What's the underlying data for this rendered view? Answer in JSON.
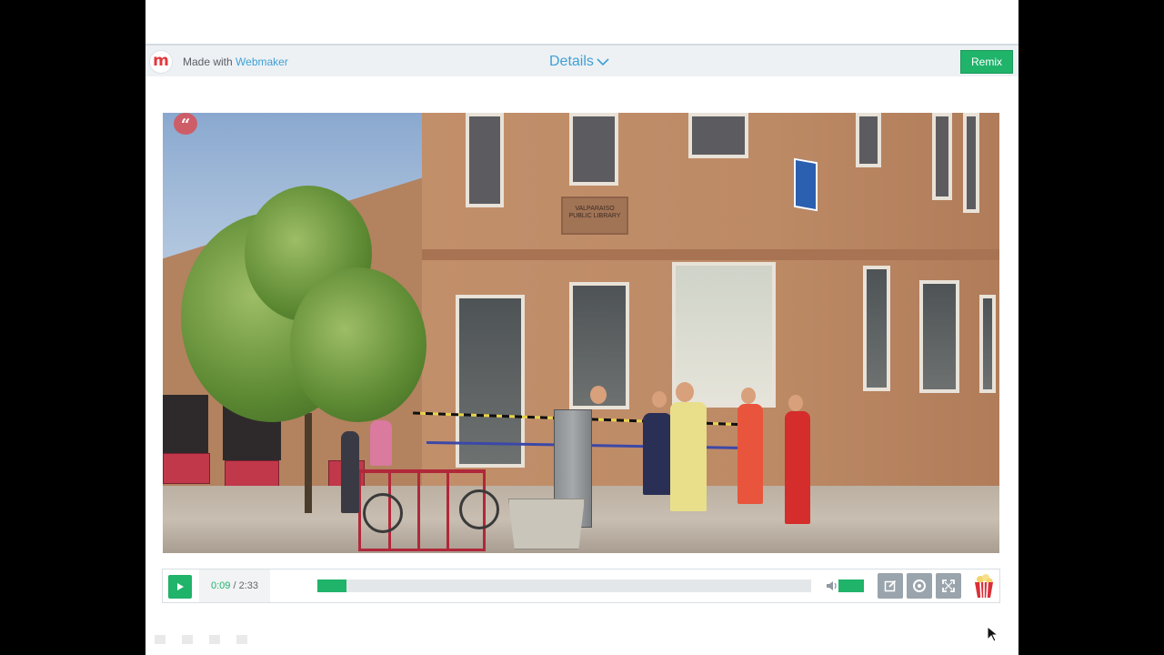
{
  "header": {
    "logo_letter": "m",
    "made_with_prefix": "Made with",
    "made_with_brand": "Webmaker",
    "details_label": "Details",
    "remix_label": "Remix"
  },
  "video": {
    "quote_glyph": "“",
    "plaque_text": "VALPARAISO PUBLIC LIBRARY",
    "window_lettering": "VALPARAISO PUBLIC LIBRARY"
  },
  "player": {
    "current_time": "0:09",
    "separator": " / ",
    "duration": "2:33",
    "progress_fraction": 0.059,
    "volume_level": 1.0,
    "accent_color": "#20b36a"
  },
  "icons": {
    "logo": "webmaker-logo-icon",
    "details_chevron": "chevron-down-icon",
    "play": "play-icon",
    "volume": "speaker-icon",
    "edit": "edit-icon",
    "share": "share-icon",
    "fullscreen": "fullscreen-icon",
    "popcorn": "popcorn-icon",
    "cursor": "mouse-pointer-icon"
  }
}
